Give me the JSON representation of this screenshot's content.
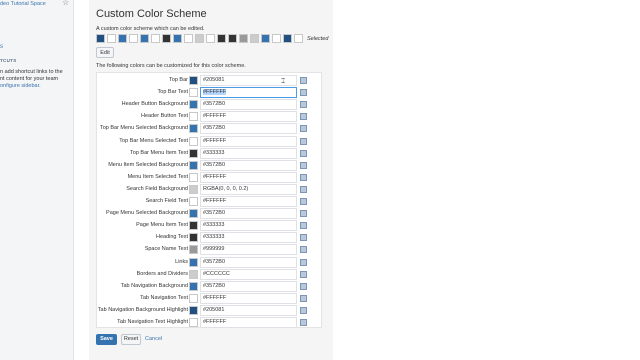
{
  "sidebar": {
    "space_name": "deo Tutorial Space",
    "heading": "TCUTS",
    "text_lines": [
      "n add shortcut links to the",
      "nt content for your team"
    ],
    "link_text": "onfigure sidebar."
  },
  "panel": {
    "title": "Custom Color Scheme",
    "custom_desc": "A custom color scheme which can be edited.",
    "scheme_swatches": [
      "#205081",
      "#ffffff",
      "#3572b0",
      "#ffffff",
      "#3572b0",
      "#ffffff",
      "#333333",
      "#3572b0",
      "#ffffff",
      "#cccccc",
      "#ffffff",
      "#333333",
      "#333333",
      "#999999",
      "#cccccc",
      "#3572b0",
      "#ffffff",
      "#205081",
      "#ffffff"
    ],
    "selected_label": "Selected",
    "edit_label": "Edit",
    "customize_desc": "The following colors can be customized for this color scheme.",
    "rows": [
      {
        "label": "Top Bar",
        "color": "#205081",
        "value": "#205081"
      },
      {
        "label": "Top Bar Text",
        "color": "#ffffff",
        "value": "#FFFFFF"
      },
      {
        "label": "Header Button Background",
        "color": "#3572b0",
        "value": "#3572B0"
      },
      {
        "label": "Header Button Text",
        "color": "#ffffff",
        "value": "#FFFFFF"
      },
      {
        "label": "Top Bar Menu Selected Background",
        "color": "#3572b0",
        "value": "#3572B0"
      },
      {
        "label": "Top Bar Menu Selected Text",
        "color": "#ffffff",
        "value": "#FFFFFF"
      },
      {
        "label": "Top Bar Menu Item Text",
        "color": "#333333",
        "value": "#333333"
      },
      {
        "label": "Menu Item Selected Background",
        "color": "#3572b0",
        "value": "#3572B0"
      },
      {
        "label": "Menu Item Selected Text",
        "color": "#ffffff",
        "value": "#FFFFFF"
      },
      {
        "label": "Search Field Background",
        "color": "#cccccc",
        "value": "RGBA(0, 0, 0, 0.2)"
      },
      {
        "label": "Search Field Text",
        "color": "#ffffff",
        "value": "#FFFFFF"
      },
      {
        "label": "Page Menu Selected Background",
        "color": "#3572b0",
        "value": "#3572B0"
      },
      {
        "label": "Page Menu Item Text",
        "color": "#333333",
        "value": "#333333"
      },
      {
        "label": "Heading Text",
        "color": "#333333",
        "value": "#333333"
      },
      {
        "label": "Space Name Text",
        "color": "#999999",
        "value": "#999999"
      },
      {
        "label": "Links",
        "color": "#3572b0",
        "value": "#3572B0"
      },
      {
        "label": "Borders and Dividers",
        "color": "#cccccc",
        "value": "#CCCCCC"
      },
      {
        "label": "Tab Navigation Background",
        "color": "#3572b0",
        "value": "#3572B0"
      },
      {
        "label": "Tab Navigation Text",
        "color": "#ffffff",
        "value": "#FFFFFF"
      },
      {
        "label": "Tab Navigation Background Highlight",
        "color": "#205081",
        "value": "#205081"
      },
      {
        "label": "Tab Navigation Text Highlight",
        "color": "#ffffff",
        "value": "#FFFFFF"
      }
    ],
    "focused_row": 1,
    "save_label": "Save",
    "reset_label": "Reset",
    "cancel_label": "Cancel"
  },
  "icons": {
    "star": "star-icon",
    "color_picker": "color-picker-icon",
    "cursor": "text-cursor-icon"
  },
  "colors": {
    "accent": "#3572b0",
    "topbar": "#205081",
    "link": "#3b73af",
    "focus": "#4a9ae8"
  }
}
